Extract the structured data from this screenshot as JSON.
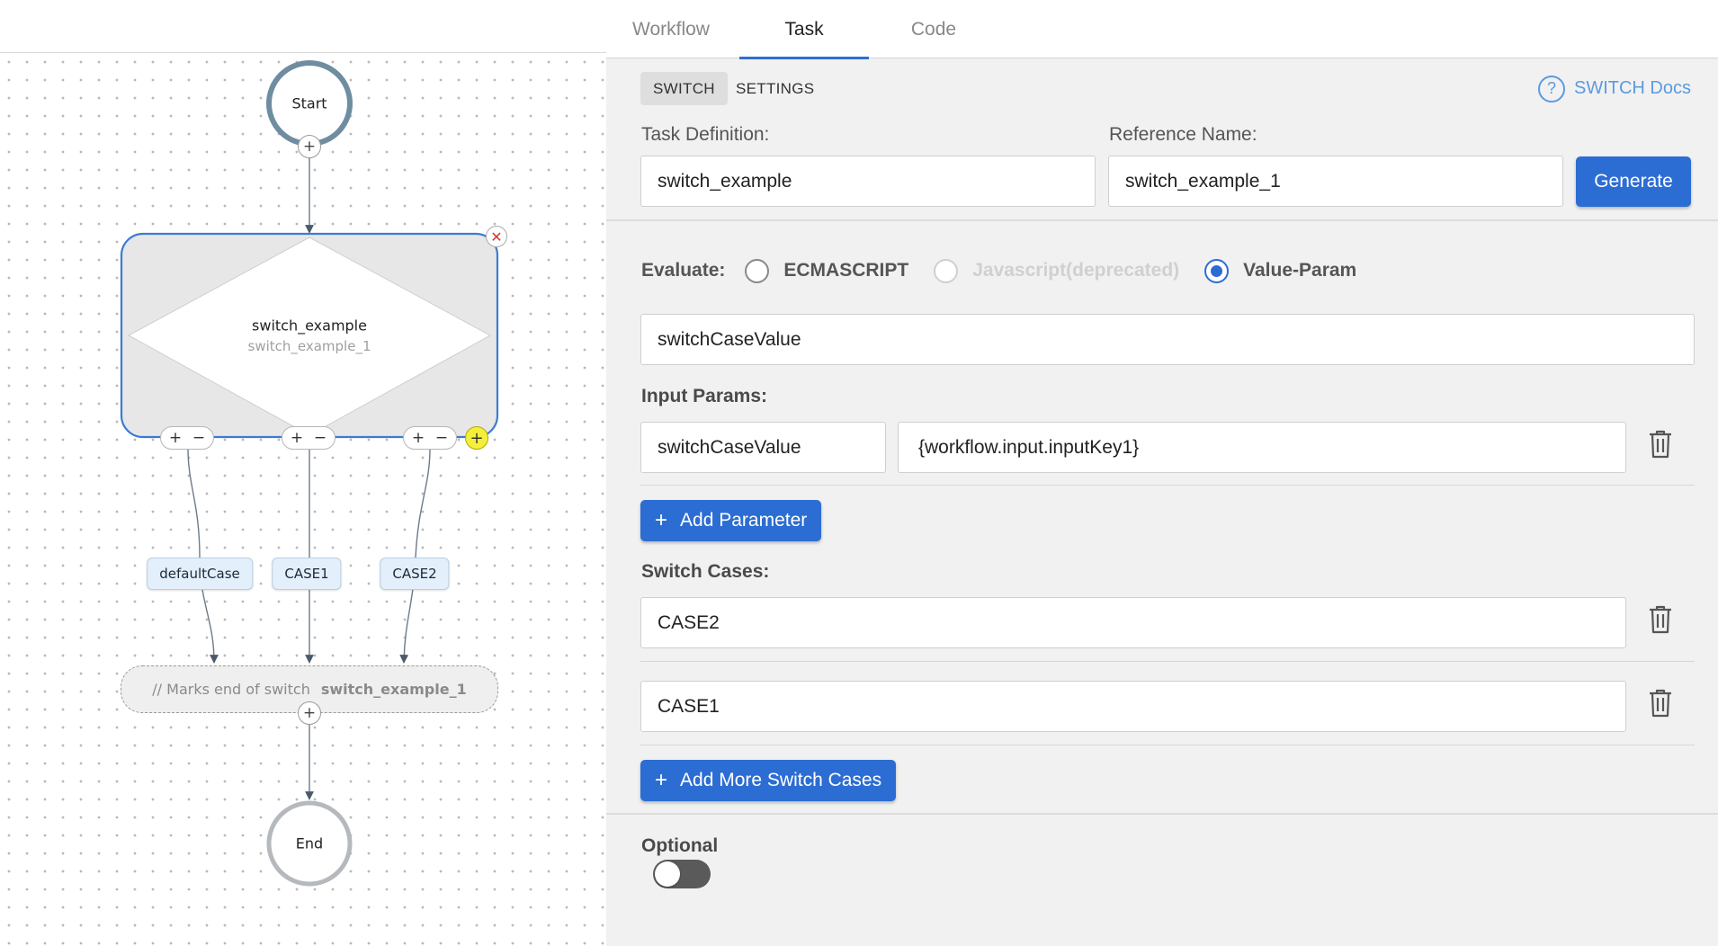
{
  "flow": {
    "start_label": "Start",
    "end_label": "End",
    "switch_task_name": "switch_example",
    "switch_ref_name": "switch_example_1",
    "cases": [
      "defaultCase",
      "CASE1",
      "CASE2"
    ],
    "end_marker_prefix": "// Marks end of switch",
    "end_marker_ref": "switch_example_1",
    "plus_glyph": "+",
    "minus_glyph": "−",
    "close_glyph": "✕"
  },
  "panel": {
    "tabs": [
      {
        "label": "Workflow",
        "active": false
      },
      {
        "label": "Task",
        "active": true
      },
      {
        "label": "Code",
        "active": false
      }
    ],
    "subtabs": [
      {
        "label": "SWITCH",
        "active": true
      },
      {
        "label": "SETTINGS",
        "active": false
      }
    ],
    "docs_label": "SWITCH Docs",
    "docs_icon": "?",
    "task_definition_label": "Task Definition:",
    "task_definition_value": "switch_example",
    "reference_name_label": "Reference Name:",
    "reference_name_value": "switch_example_1",
    "generate_label": "Generate",
    "evaluate_label": "Evaluate:",
    "evaluator_options": [
      {
        "label": "ECMASCRIPT",
        "state": "unchecked"
      },
      {
        "label": "Javascript(deprecated)",
        "state": "disabled"
      },
      {
        "label": "Value-Param",
        "state": "checked"
      }
    ],
    "expression_value": "switchCaseValue",
    "input_params_label": "Input Params:",
    "input_params": [
      {
        "key": "switchCaseValue",
        "value": "{workflow.input.inputKey1}"
      }
    ],
    "add_parameter_label": "Add Parameter",
    "switch_cases_label": "Switch Cases:",
    "switch_cases": [
      "CASE2",
      "CASE1"
    ],
    "add_cases_label": "Add More Switch Cases",
    "optional_label": "Optional",
    "optional_enabled": false,
    "accent_color": "#2c6dd3"
  }
}
